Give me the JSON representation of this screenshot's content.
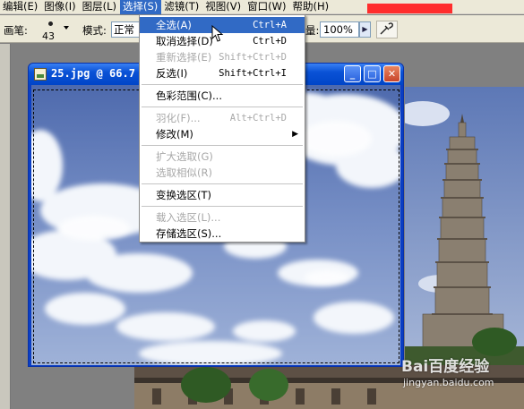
{
  "menubar": {
    "items": [
      {
        "label": "编辑(E)"
      },
      {
        "label": "图像(I)"
      },
      {
        "label": "图层(L)"
      },
      {
        "label": "选择(S)",
        "active": true
      },
      {
        "label": "滤镜(T)"
      },
      {
        "label": "视图(V)"
      },
      {
        "label": "窗口(W)"
      },
      {
        "label": "帮助(H)"
      }
    ]
  },
  "options": {
    "brush_label": "画笔:",
    "brush_size": "43",
    "mode_label": "模式:",
    "mode_value": "正常",
    "flow_label": "量:",
    "flow_value": "100%",
    "flow_button": "▶",
    "airbrush_icon": "airbrush-icon"
  },
  "document": {
    "title": "25.jpg @ 66.7",
    "minimize": "_",
    "maximize": "□",
    "close": "✕"
  },
  "select_menu": {
    "items": [
      {
        "type": "item",
        "label": "全选(A)",
        "shortcut": "Ctrl+A",
        "highlighted": true,
        "disabled": false
      },
      {
        "type": "item",
        "label": "取消选择(D)",
        "shortcut": "Ctrl+D",
        "highlighted": false,
        "disabled": false
      },
      {
        "type": "item",
        "label": "重新选择(E)",
        "shortcut": "Shift+Ctrl+D",
        "highlighted": false,
        "disabled": true
      },
      {
        "type": "item",
        "label": "反选(I)",
        "shortcut": "Shift+Ctrl+I",
        "highlighted": false,
        "disabled": false
      },
      {
        "type": "sep"
      },
      {
        "type": "item",
        "label": "色彩范围(C)...",
        "shortcut": "",
        "highlighted": false,
        "disabled": false
      },
      {
        "type": "sep"
      },
      {
        "type": "item",
        "label": "羽化(F)...",
        "shortcut": "Alt+Ctrl+D",
        "highlighted": false,
        "disabled": true
      },
      {
        "type": "item",
        "label": "修改(M)",
        "shortcut": "",
        "highlighted": false,
        "disabled": false,
        "submenu": true
      },
      {
        "type": "sep"
      },
      {
        "type": "item",
        "label": "扩大选取(G)",
        "shortcut": "",
        "highlighted": false,
        "disabled": true
      },
      {
        "type": "item",
        "label": "选取相似(R)",
        "shortcut": "",
        "highlighted": false,
        "disabled": true
      },
      {
        "type": "sep"
      },
      {
        "type": "item",
        "label": "变换选区(T)",
        "shortcut": "",
        "highlighted": false,
        "disabled": false
      },
      {
        "type": "sep"
      },
      {
        "type": "item",
        "label": "载入选区(L)...",
        "shortcut": "",
        "highlighted": false,
        "disabled": true
      },
      {
        "type": "item",
        "label": "存储选区(S)...",
        "shortcut": "",
        "highlighted": false,
        "disabled": false
      }
    ]
  },
  "watermark": {
    "logo": "Bai百度经验",
    "url": "jingyan.baidu.com"
  },
  "colors": {
    "highlight": "#316ac5",
    "titlebar": "#0a52d6",
    "menubar": "#ece9d8",
    "sky": "#6b86c4"
  }
}
